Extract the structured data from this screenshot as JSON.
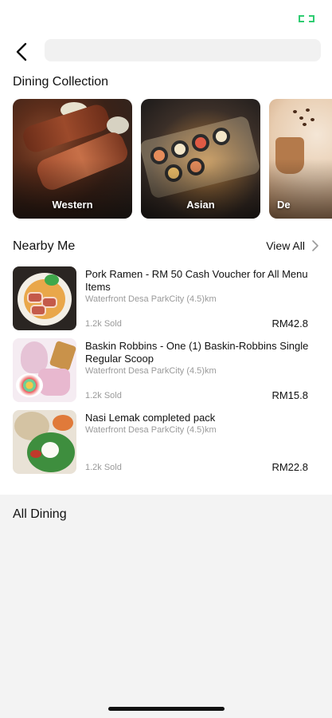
{
  "search": {
    "placeholder": ""
  },
  "dining_collection": {
    "title": "Dining Collection",
    "cards": [
      {
        "label": "Western"
      },
      {
        "label": "Asian"
      },
      {
        "label": "De"
      }
    ]
  },
  "nearby": {
    "title": "Nearby Me",
    "view_all": "View All",
    "items": [
      {
        "title": "Pork Ramen - RM 50 Cash Voucher for All Menu Items",
        "location": "Waterfront Desa ParkCity (4.5)km",
        "sold": "1.2k Sold",
        "price": "RM42.8"
      },
      {
        "title": "Baskin Robbins - One (1) Baskin-Robbins Single Regular Scoop",
        "location": "Waterfront Desa ParkCity (4.5)km",
        "sold": "1.2k Sold",
        "price": "RM15.8"
      },
      {
        "title": "Nasi Lemak completed pack",
        "location": "Waterfront Desa ParkCity (4.5)km",
        "sold": "1.2k Sold",
        "price": "RM22.8"
      }
    ]
  },
  "all_dining": {
    "title": "All Dining"
  },
  "icons": {
    "back": "back-arrow-icon",
    "view_all": "chevron-right-icon",
    "status": "connection-icon"
  },
  "colors": {
    "status_accent": "#2ecc71",
    "grey_background": "#f3f3f3"
  }
}
